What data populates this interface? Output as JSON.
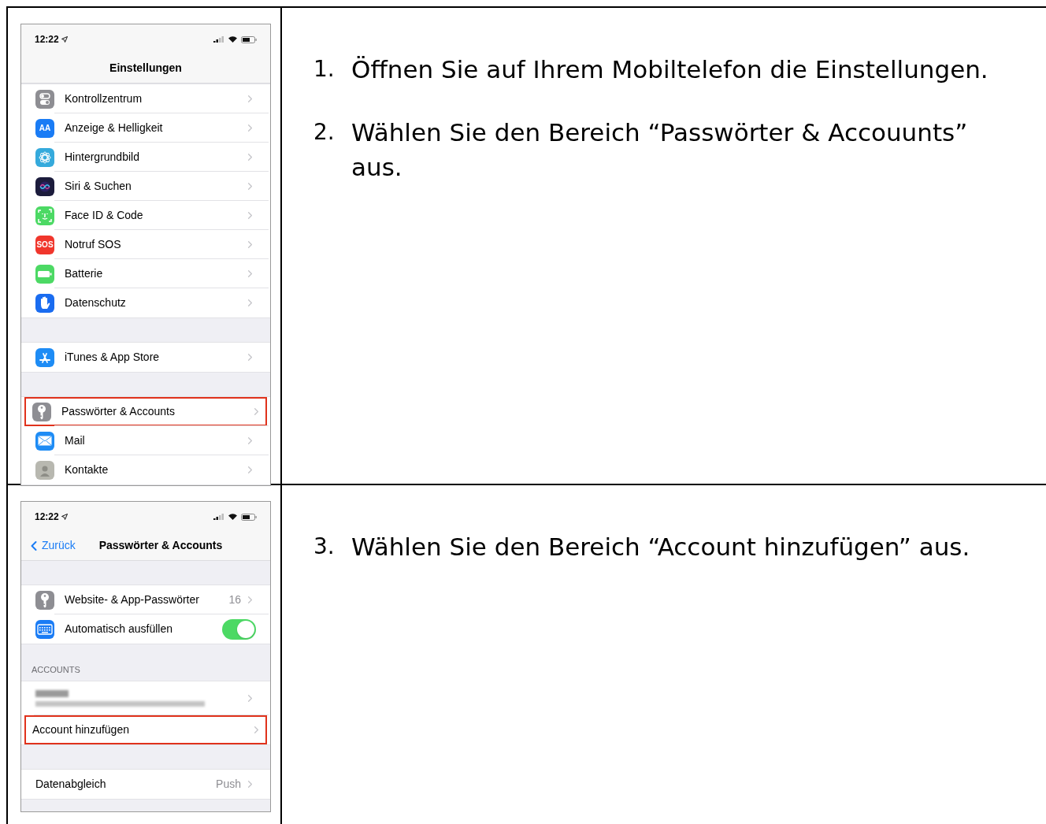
{
  "rows": [
    {
      "screen": {
        "status_time": "12:22",
        "title": "Einstellungen",
        "groups": [
          {
            "items": [
              {
                "label": "Kontrollzentrum",
                "color": "#8e8e93",
                "kind": "nav",
                "highlighted": false
              },
              {
                "label": "Anzeige & Helligkeit",
                "color": "#1a7cf5",
                "icon_text": "AA",
                "kind": "nav",
                "highlighted": false
              },
              {
                "label": "Hintergrundbild",
                "color": "#35aadc",
                "kind": "nav",
                "highlighted": false
              },
              {
                "label": "Siri & Suchen",
                "color": "#1c1c3c",
                "kind": "nav",
                "highlighted": false
              },
              {
                "label": "Face ID & Code",
                "color": "#4cd964",
                "kind": "nav",
                "highlighted": false
              },
              {
                "label": "Notruf SOS",
                "color": "#f0362c",
                "icon_text": "SOS",
                "kind": "nav",
                "highlighted": false
              },
              {
                "label": "Batterie",
                "color": "#4cd964",
                "kind": "nav",
                "highlighted": false
              },
              {
                "label": "Datenschutz",
                "color": "#1a6cf0",
                "kind": "nav",
                "highlighted": false
              }
            ]
          },
          {
            "items": [
              {
                "label": "iTunes & App Store",
                "color": "#1e8cf5",
                "kind": "nav",
                "highlighted": false
              }
            ]
          },
          {
            "items": [
              {
                "label": "Passwörter & Accounts",
                "color": "#8e8e93",
                "kind": "nav",
                "highlighted": true
              },
              {
                "label": "Mail",
                "color": "#1e8cf5",
                "kind": "nav",
                "highlighted": false
              },
              {
                "label": "Kontakte",
                "color": "#b8b8b0",
                "kind": "nav",
                "highlighted": false
              }
            ]
          }
        ]
      },
      "steps": [
        {
          "number": "1.",
          "text": "Öffnen Sie auf Ihrem Mobiltelefon die Einstellungen."
        },
        {
          "number": "2.",
          "text": "Wählen Sie den Bereich “Passwörter & Accouunts” aus."
        }
      ]
    },
    {
      "screen": {
        "status_time": "12:22",
        "back": "Zurück",
        "title": "Passwörter & Accounts",
        "groups": [
          {
            "items": [
              {
                "label": "Website- & App-Passwörter",
                "color": "#8e8e93",
                "value": "16",
                "kind": "nav",
                "highlighted": false
              },
              {
                "label": "Automatisch ausfüllen",
                "color": "#1a7cf5",
                "kind": "toggle",
                "on": true,
                "highlighted": false
              }
            ]
          },
          {
            "header": "ACCOUNTS",
            "items": [
              {
                "kind": "redacted",
                "highlighted": false
              },
              {
                "label": "Account hinzufügen",
                "kind": "nav",
                "highlighted": true
              }
            ]
          },
          {
            "items": [
              {
                "label": "Datenabgleich",
                "value": "Push",
                "kind": "nav",
                "highlighted": false
              }
            ]
          }
        ]
      },
      "steps": [
        {
          "number": "3.",
          "text": "Wählen Sie den Bereich “Account hinzufügen” aus."
        }
      ]
    }
  ]
}
